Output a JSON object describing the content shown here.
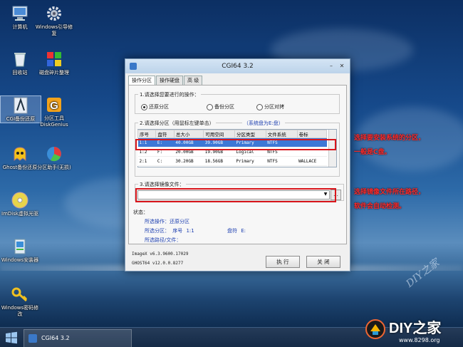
{
  "desktop": {
    "icons": [
      {
        "label": "计算机"
      },
      {
        "label": "Windows引导修复"
      },
      {
        "label": "回收站"
      },
      {
        "label": "磁盘碎片整理"
      },
      {
        "label": "CGI备份还原"
      },
      {
        "label": "分区工具DiskGenius"
      },
      {
        "label": "Ghost备份还原"
      },
      {
        "label": "分区助手(无损)"
      },
      {
        "label": "ImDisk虚拟光驱"
      },
      {
        "label": "Windows安装器"
      },
      {
        "label": "Windows密码修改"
      }
    ]
  },
  "window": {
    "title": "CGI64  3.2",
    "tabs": [
      "操作分区",
      "操作硬盘",
      "高 级"
    ],
    "section1": {
      "legend": "1.请选择您要进行的操作：",
      "options": [
        "还原分区",
        "备份分区",
        "分区对拷"
      ],
      "selected": 0
    },
    "section2": {
      "legend": "2.请选择分区（用鼠标左键单击）",
      "system_disk": "（系统盘为E:盘）",
      "columns": [
        "序号",
        "盘符",
        "总大小",
        "可用空间",
        "分区类型",
        "文件系统",
        "卷标"
      ],
      "rows": [
        [
          "1:1",
          "E:",
          "40.00GB",
          "39.90GB",
          "Primary",
          "NTFS",
          ""
        ],
        [
          "1:2",
          "F:",
          "20.00GB",
          "19.90GB",
          "Logical",
          "NTFS",
          ""
        ],
        [
          "2:1",
          "C:",
          "30.20GB",
          "18.56GB",
          "Primary",
          "NTFS",
          "WALLACE"
        ]
      ],
      "selected_row": 0
    },
    "section3": {
      "legend": "3.请选择镜像文件：",
      "value": "",
      "browse": "..."
    },
    "status": {
      "label": "状态：",
      "op_label": "所选操作：",
      "op_value": "还原分区",
      "part_label": "所选分区：",
      "seq_label": "序号",
      "seq_value": "1:1",
      "disk_label": "盘符",
      "disk_value": "E:",
      "path_label": "所选路径/文件："
    },
    "versions": [
      "ImageX v6.3.9600.17029",
      "GHOST64 v12.0.0.8277"
    ],
    "buttons": {
      "execute": "执 行",
      "close": "关 闭"
    }
  },
  "annotations": {
    "note1_line1": "选择要安装系统的分区，",
    "note1_line2": "一般是C盘。",
    "note2_line1": "选择镜像文件所在路径，",
    "note2_line2": "软件会自动检测。",
    "highlight_color": "#d9161c"
  },
  "taskbar": {
    "app_label": "CGI64  3.2"
  },
  "branding": {
    "title": "DIY之家",
    "url": "www.8298.org",
    "watermark": "DIY之家"
  }
}
